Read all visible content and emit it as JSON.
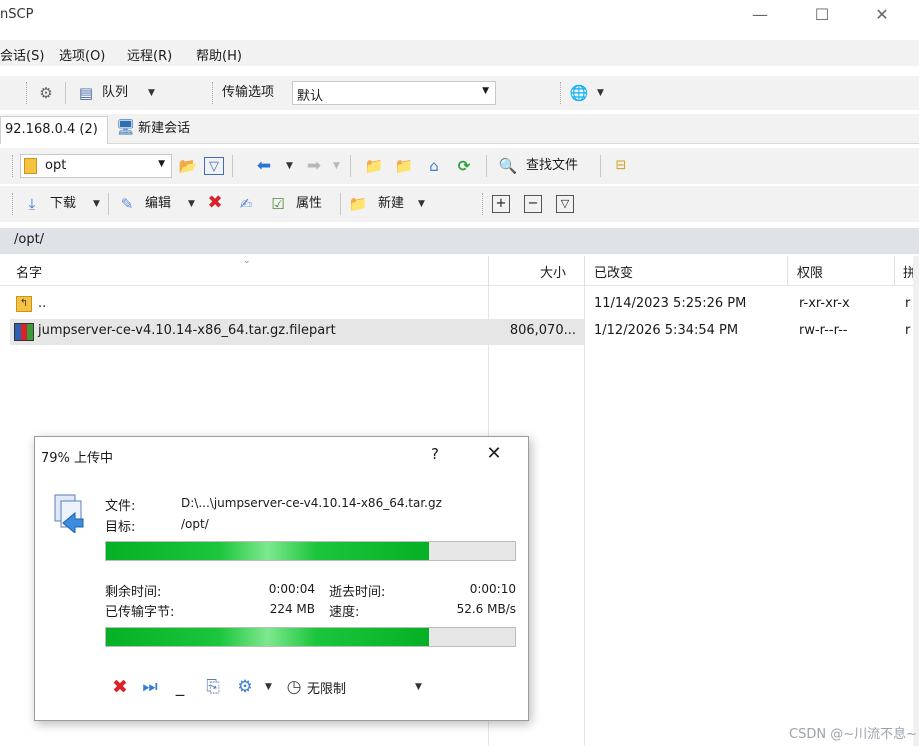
{
  "window": {
    "title": "nSCP",
    "minimize": "—",
    "maximize": "☐",
    "close": "✕"
  },
  "menu": [
    "会话(S)",
    "选项(O)",
    "远程(R)",
    "帮助(H)"
  ],
  "toolbar1": {
    "queue_label": "队列",
    "transfer_label": "传输选项",
    "transfer_value": "默认"
  },
  "tabs": {
    "session": "92.168.0.4 (2)",
    "new_session": "新建会话"
  },
  "toolbar2": {
    "path_combo": "opt",
    "find_files": "查找文件"
  },
  "toolbar3": {
    "download": "下载",
    "edit": "编辑",
    "properties": "属性",
    "new": "新建"
  },
  "path": "/opt/",
  "columns": {
    "name": "名字",
    "size": "大小",
    "changed": "已改变",
    "rights": "权限",
    "owner": "拼"
  },
  "files": [
    {
      "name": "..",
      "size": "",
      "changed": "11/14/2023 5:25:26 PM",
      "rights": "r-xr-xr-x",
      "owner": "r"
    },
    {
      "name": "jumpserver-ce-v4.10.14-x86_64.tar.gz.filepart",
      "size": "806,070...",
      "changed": "1/12/2026 5:34:54 PM",
      "rights": "rw-r--r--",
      "owner": "r"
    }
  ],
  "dialog": {
    "title": "79% 上传中",
    "help": "?",
    "close": "✕",
    "file_label": "文件:",
    "file_value": "D:\\...\\jumpserver-ce-v4.10.14-x86_64.tar.gz",
    "target_label": "目标:",
    "target_value": "/opt/",
    "file_progress": 0.79,
    "remaining_label": "剩余时间:",
    "remaining_value": "0:00:04",
    "elapsed_label": "逝去时间:",
    "elapsed_value": "0:00:10",
    "transferred_label": "已传输字节:",
    "transferred_value": "224 MB",
    "speed_label": "速度:",
    "speed_value": "52.6 MB/s",
    "total_progress": 0.79,
    "speed_limit": "无限制"
  },
  "watermark": "CSDN @~川流不息~"
}
